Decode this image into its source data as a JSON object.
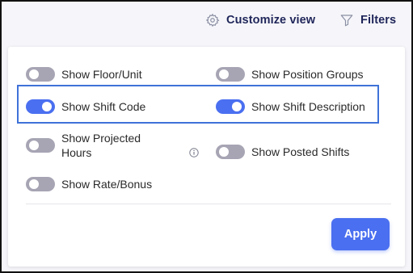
{
  "topbar": {
    "customize_label": "Customize view",
    "filters_label": "Filters"
  },
  "options": [
    {
      "label": "Show Floor/Unit",
      "enabled": false
    },
    {
      "label": "Show Position Groups",
      "enabled": false
    },
    {
      "label": "Show Shift Code",
      "enabled": true
    },
    {
      "label": "Show Shift Description",
      "enabled": true
    },
    {
      "label": "Show Projected Hours",
      "enabled": false
    },
    {
      "label": "Show Posted Shifts",
      "enabled": false
    },
    {
      "label": "Show Rate/Bonus",
      "enabled": false
    }
  ],
  "apply_label": "Apply",
  "colors": {
    "accent": "#4a6ff0",
    "toggle_off": "#a7a5b4",
    "highlight_border": "#3f72d8",
    "nav_text": "#1f2559"
  }
}
